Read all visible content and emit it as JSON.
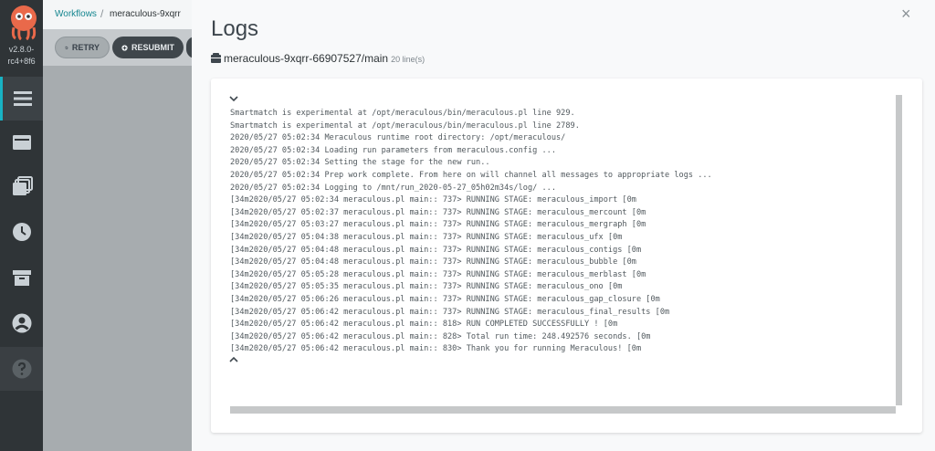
{
  "app": {
    "version": "v2.8.0-rc4+8f6"
  },
  "nav": {
    "items": [
      {
        "icon": "timeline-icon",
        "active": true
      },
      {
        "icon": "workflow-templates-icon",
        "active": false
      },
      {
        "icon": "cluster-templates-icon",
        "active": false
      },
      {
        "icon": "cron-icon",
        "active": false
      },
      {
        "icon": "archive-icon",
        "active": false
      },
      {
        "icon": "user-icon",
        "active": false
      },
      {
        "icon": "help-icon",
        "active": false
      }
    ]
  },
  "breadcrumb": {
    "link": "Workflows",
    "separator": "/",
    "current": "meraculous-9xqrr"
  },
  "toolbar": {
    "retry_label": "RETRY",
    "resubmit_label": "RESUBMIT"
  },
  "panel": {
    "title": "Logs",
    "node_name": "meraculous-9xqrr-66907527/main",
    "line_count": "20 line(s)",
    "close_glyph": "×"
  },
  "logs": [
    "Smartmatch is experimental at /opt/meraculous/bin/meraculous.pl line 929.",
    "Smartmatch is experimental at /opt/meraculous/bin/meraculous.pl line 2789.",
    "2020/05/27 05:02:34 Meraculous runtime root directory: /opt/meraculous/",
    "2020/05/27 05:02:34 Loading run parameters from meraculous.config ...",
    "2020/05/27 05:02:34 Setting the stage for the new run..",
    "2020/05/27 05:02:34 Prep work complete. From here on will channel all messages to appropriate logs ...",
    "2020/05/27 05:02:34 Logging to /mnt/run_2020-05-27_05h02m34s/log/ ...",
    "[34m2020/05/27 05:02:34 meraculous.pl main:: 737> RUNNING STAGE: meraculous_import [0m",
    "[34m2020/05/27 05:02:37 meraculous.pl main:: 737> RUNNING STAGE: meraculous_mercount [0m",
    "[34m2020/05/27 05:03:27 meraculous.pl main:: 737> RUNNING STAGE: meraculous_mergraph [0m",
    "[34m2020/05/27 05:04:38 meraculous.pl main:: 737> RUNNING STAGE: meraculous_ufx [0m",
    "[34m2020/05/27 05:04:48 meraculous.pl main:: 737> RUNNING STAGE: meraculous_contigs [0m",
    "[34m2020/05/27 05:04:48 meraculous.pl main:: 737> RUNNING STAGE: meraculous_bubble [0m",
    "[34m2020/05/27 05:05:28 meraculous.pl main:: 737> RUNNING STAGE: meraculous_merblast [0m",
    "[34m2020/05/27 05:05:35 meraculous.pl main:: 737> RUNNING STAGE: meraculous_ono [0m",
    "[34m2020/05/27 05:06:26 meraculous.pl main:: 737> RUNNING STAGE: meraculous_gap_closure [0m",
    "[34m2020/05/27 05:06:42 meraculous.pl main:: 737> RUNNING STAGE: meraculous_final_results [0m",
    "[34m2020/05/27 05:06:42 meraculous.pl main:: 818> RUN COMPLETED SUCCESSFULLY ! [0m",
    "[34m2020/05/27 05:06:42 meraculous.pl main:: 828> Total run time: 248.492576 seconds. [0m",
    "[34m2020/05/27 05:06:42 meraculous.pl main:: 830> Thank you for running Meraculous! [0m"
  ],
  "colors": {
    "nav_bg": "#2f3437",
    "accent": "#18b3c4",
    "panel_bg": "#f8f9fa",
    "log_text": "#51595e"
  }
}
